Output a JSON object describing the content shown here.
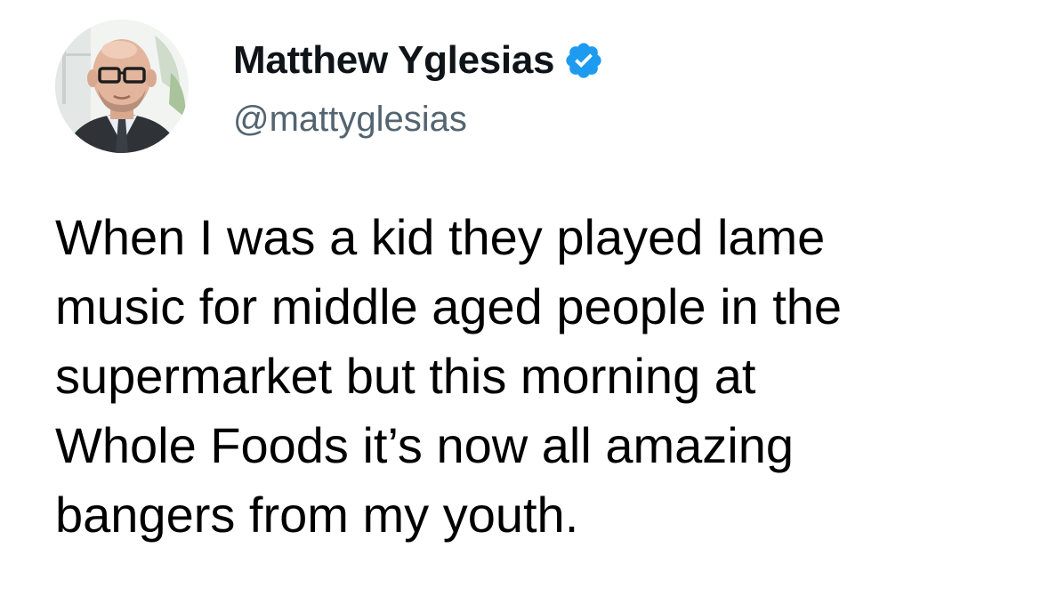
{
  "tweet": {
    "author": {
      "display_name": "Matthew Yglesias",
      "handle": "@mattyglesias",
      "verified": true,
      "avatar_icon": "profile-photo"
    },
    "text": "When I was a kid they played lame\nmusic for middle aged people in the\nsupermarket but this morning at\nWhole Foods it’s now all amazing\nbangers from my youth."
  },
  "colors": {
    "verified_badge": "#1d9bf0",
    "handle": "#536471",
    "text": "#000000"
  }
}
